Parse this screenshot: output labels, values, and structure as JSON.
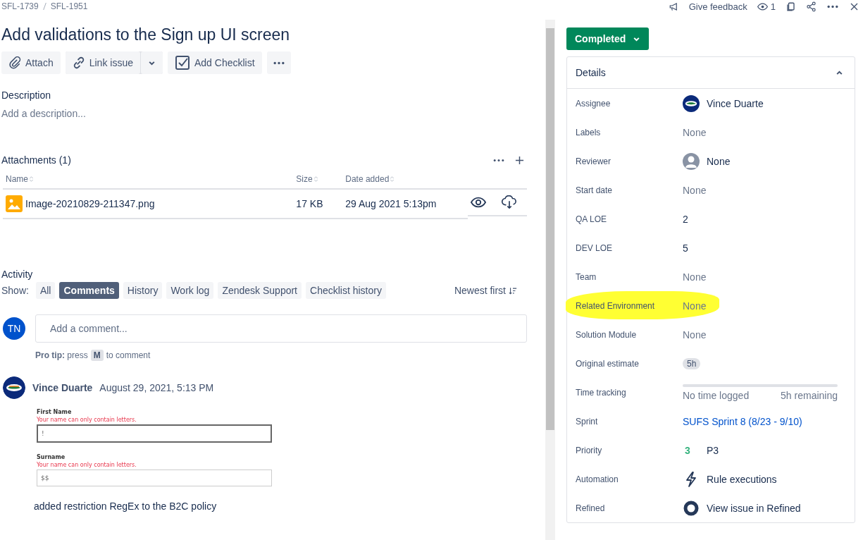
{
  "breadcrumbs": [
    "SFL-1739",
    "SFL-1951"
  ],
  "top_actions": {
    "feedback": "Give feedback",
    "watchers": "1"
  },
  "issue": {
    "title": "Add validations to the Sign up UI screen"
  },
  "toolbar": [
    {
      "kind": "attach",
      "label": "Attach"
    },
    {
      "kind": "link",
      "label": "Link issue"
    },
    {
      "kind": "checklist",
      "label": "Add Checklist"
    }
  ],
  "description": {
    "heading": "Description",
    "placeholder": "Add a description..."
  },
  "attachments": {
    "heading": "Attachments (1)",
    "columns": [
      "Name",
      "Size",
      "Date added"
    ],
    "rows": [
      {
        "name": "Image-20210829-211347.png",
        "size": "17 KB",
        "date": "29 Aug 2021 5:13pm"
      }
    ]
  },
  "activity": {
    "heading": "Activity",
    "show_label": "Show:",
    "sort": "Newest first",
    "filters": [
      {
        "label": "All",
        "selected": false
      },
      {
        "label": "Comments",
        "selected": true
      },
      {
        "label": "History",
        "selected": false
      },
      {
        "label": "Work log",
        "selected": false
      },
      {
        "label": "Zendesk Support",
        "selected": false
      },
      {
        "label": "Checklist history",
        "selected": false
      }
    ]
  },
  "comment_box": {
    "avatar": "TN",
    "placeholder": "Add a comment...",
    "tip": "**Pro tip:** press",
    "key": "M",
    "tip_after": "to comment"
  },
  "comments": [
    {
      "author": "Vince Duarte",
      "date": "August 29, 2021, 5:13 PM",
      "text": "added restriction RegEx to the B2C policy",
      "screenshot": [
        {
          "label": "First Name",
          "error": "Your name can only contain letters.",
          "value": "!",
          "focused": true
        },
        {
          "label": "Surname",
          "error": "Your name can only contain letters.",
          "value": "$$",
          "focused": false
        }
      ]
    }
  ],
  "status": {
    "label": "Completed"
  },
  "details": {
    "heading": "Details",
    "expanded": true,
    "rows": [
      {
        "label": "Assignee",
        "kind": "user",
        "value": "Vince Duarte",
        "highlighted": false
      },
      {
        "label": "Labels",
        "kind": "empty",
        "value": "None",
        "highlighted": false
      },
      {
        "label": "Reviewer",
        "kind": "unassigned",
        "value": "None",
        "highlighted": false
      },
      {
        "label": "Start date",
        "kind": "empty",
        "value": "None",
        "highlighted": false
      },
      {
        "label": "QA LOE",
        "kind": "text",
        "value": "2",
        "highlighted": false
      },
      {
        "label": "DEV LOE",
        "kind": "text",
        "value": "5",
        "highlighted": false
      },
      {
        "label": "Team",
        "kind": "empty",
        "value": "None",
        "highlighted": false
      },
      {
        "label": "Related Environment",
        "kind": "empty",
        "value": "None",
        "highlighted": true
      },
      {
        "label": "Solution Module",
        "kind": "empty",
        "value": "None",
        "highlighted": false
      },
      {
        "label": "Original estimate",
        "kind": "badge",
        "value": "5h",
        "highlighted": false
      },
      {
        "label": "Time tracking",
        "kind": "tracking",
        "value": "No time logged",
        "remaining": "5h remaining",
        "highlighted": false
      },
      {
        "label": "Sprint",
        "kind": "link",
        "value": "SUFS Sprint 8 (8/23 - 9/10)",
        "highlighted": false
      },
      {
        "label": "Priority",
        "kind": "priority",
        "icon": "3",
        "value": "P3",
        "highlighted": false
      },
      {
        "label": "Automation",
        "kind": "automation",
        "value": "Rule executions",
        "highlighted": false
      },
      {
        "label": "Refined",
        "kind": "refined",
        "value": "View issue in Refined",
        "highlighted": false
      }
    ]
  }
}
